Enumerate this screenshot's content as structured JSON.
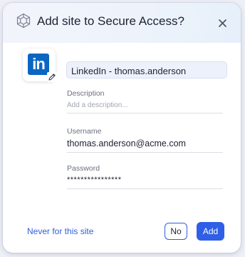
{
  "dialog": {
    "title": "Add site to Secure Access?",
    "logo_icon": "cube-network-icon",
    "close_icon": "close-icon"
  },
  "site": {
    "icon": "linkedin-logo",
    "logo_text": "in",
    "edit_icon": "pencil-icon",
    "name": "LinkedIn - thomas.anderson"
  },
  "fields": {
    "description": {
      "label": "Description",
      "placeholder": "Add a description..."
    },
    "username": {
      "label": "Username",
      "value": "thomas.anderson@acme.com"
    },
    "password": {
      "label": "Password",
      "value": "****************"
    }
  },
  "actions": {
    "never_label": "Never for this site",
    "no_label": "No",
    "add_label": "Add"
  },
  "colors": {
    "accent": "#2f5fe6",
    "linkedin": "#0a66c2",
    "text": "#1e2233"
  }
}
